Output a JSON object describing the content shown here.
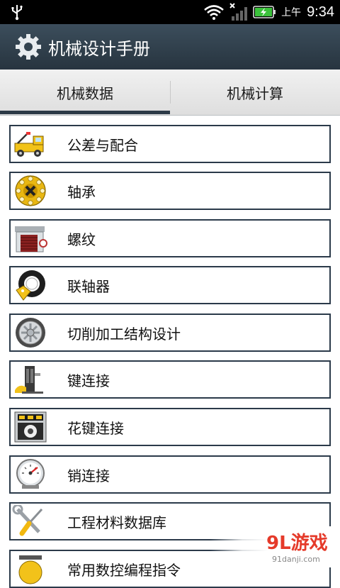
{
  "status_bar": {
    "ampm": "上午",
    "time": "9:34"
  },
  "app": {
    "title": "机械设计手册"
  },
  "tabs": [
    {
      "label": "机械数据"
    },
    {
      "label": "机械计算"
    }
  ],
  "list": [
    {
      "label": "公差与配合",
      "icon": "tow-truck-icon"
    },
    {
      "label": "轴承",
      "icon": "bearing-icon"
    },
    {
      "label": "螺纹",
      "icon": "garage-icon"
    },
    {
      "label": "联轴器",
      "icon": "tire-tag-icon"
    },
    {
      "label": "切削加工结构设计",
      "icon": "wheel-rim-icon"
    },
    {
      "label": "键连接",
      "icon": "key-machine-icon"
    },
    {
      "label": "花键连接",
      "icon": "spline-machine-icon"
    },
    {
      "label": "销连接",
      "icon": "gauge-icon"
    },
    {
      "label": "工程材料数据库",
      "icon": "wrench-screwdriver-icon"
    },
    {
      "label": "常用数控编程指令",
      "icon": "cnc-icon"
    }
  ],
  "watermark": {
    "logo": "9L游戏",
    "url": "91danji.com"
  }
}
